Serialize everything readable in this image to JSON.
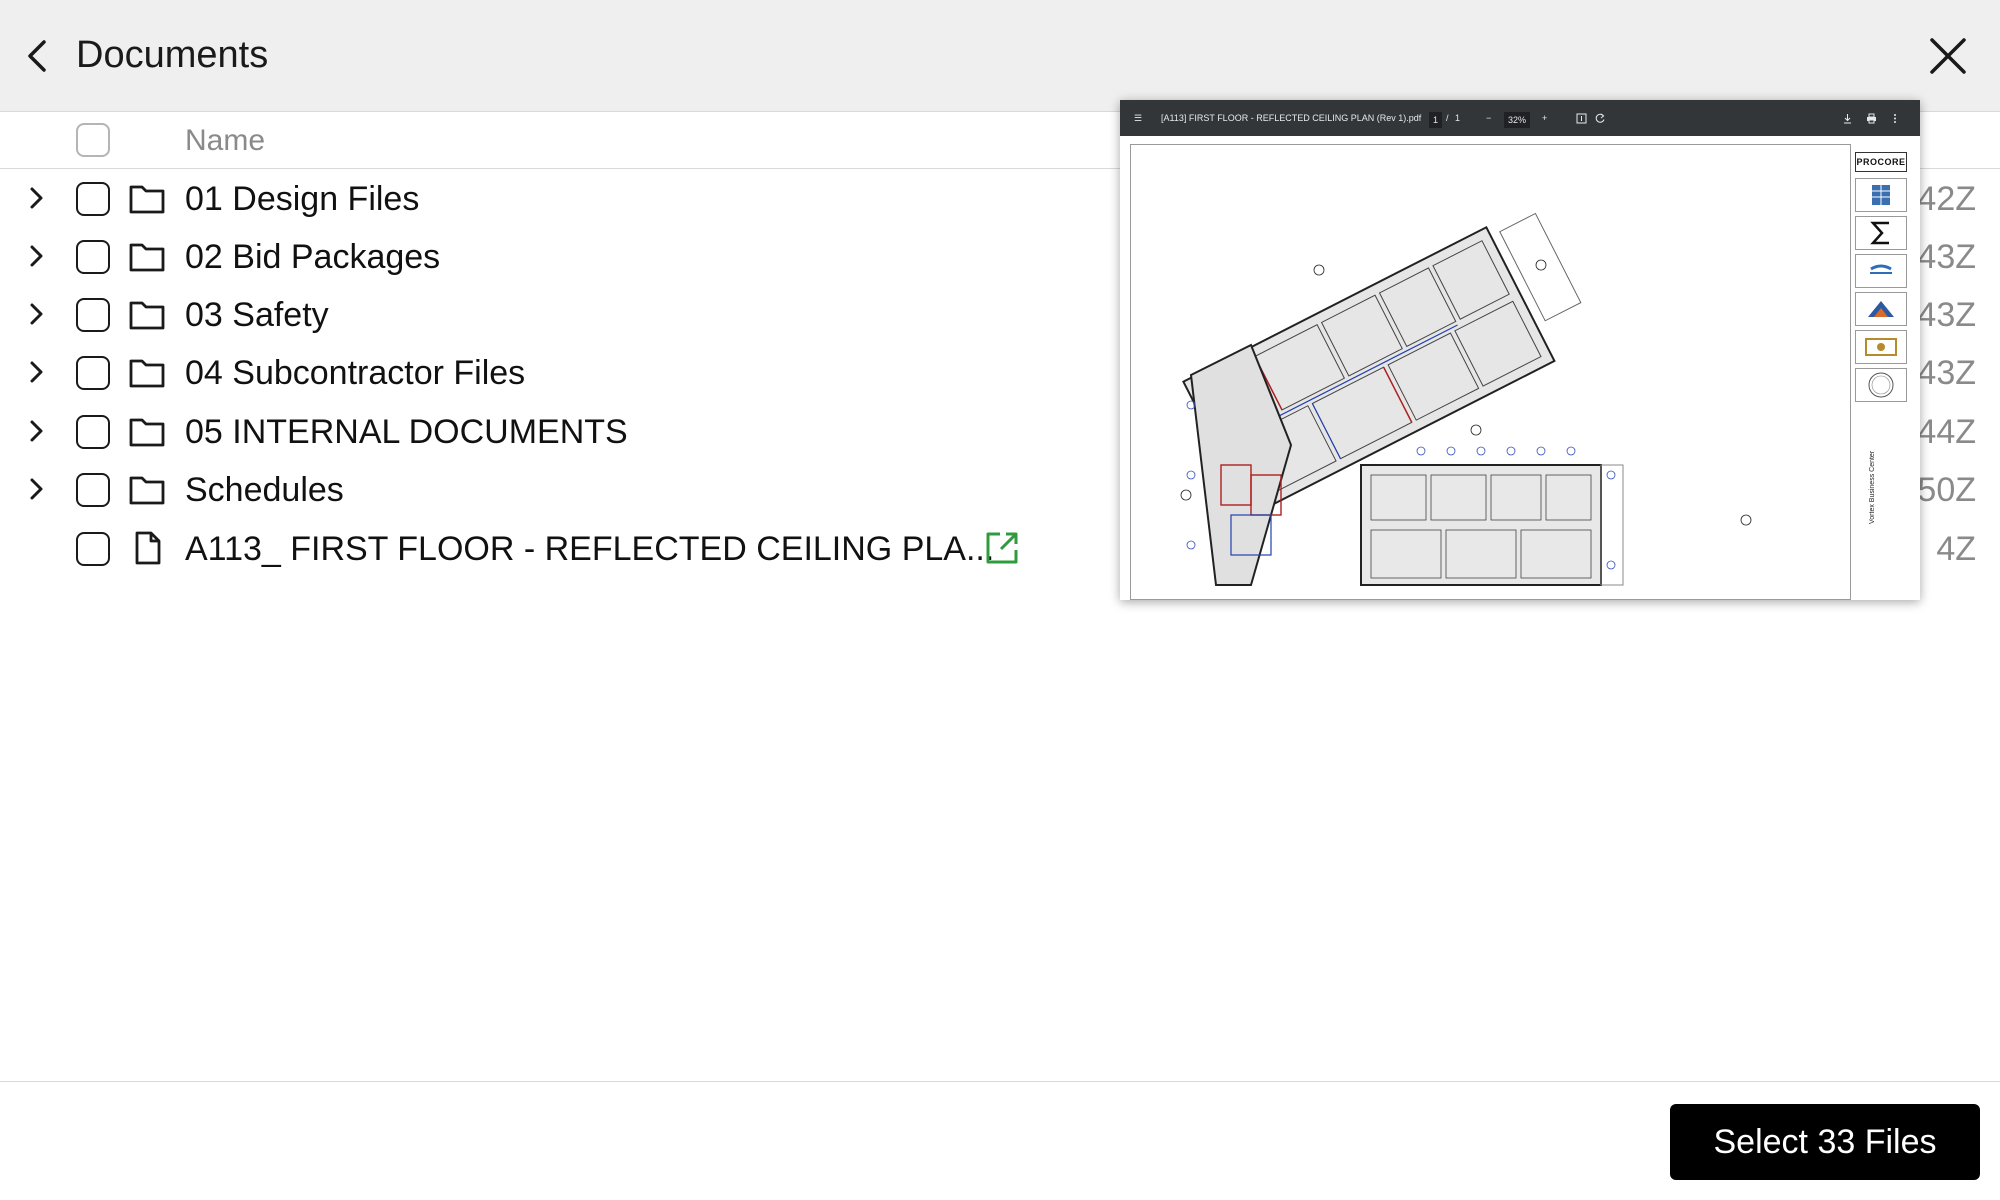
{
  "header": {
    "title": "Documents",
    "back_icon": "chevron-left-icon",
    "close_icon": "close-icon"
  },
  "table": {
    "name_column": "Name"
  },
  "rows": [
    {
      "label": "01 Design Files",
      "type": "folder",
      "date_fragment": "42Z",
      "expandable": true
    },
    {
      "label": "02 Bid Packages",
      "type": "folder",
      "date_fragment": "43Z",
      "expandable": true
    },
    {
      "label": "03 Safety",
      "type": "folder",
      "date_fragment": "43Z",
      "expandable": true
    },
    {
      "label": "04 Subcontractor Files",
      "type": "folder",
      "date_fragment": "43Z",
      "expandable": true
    },
    {
      "label": "05 INTERNAL DOCUMENTS",
      "type": "folder",
      "date_fragment": "44Z",
      "expandable": true
    },
    {
      "label": "Schedules",
      "type": "folder",
      "date_fragment": "50Z",
      "expandable": true
    },
    {
      "label": "A113_ FIRST FLOOR - REFLECTED CEILING PLA...",
      "type": "file",
      "date_fragment": "4Z",
      "expandable": false
    }
  ],
  "preview": {
    "filename": "[A113] FIRST FLOOR - REFLECTED CEILING PLAN (Rev 1).pdf",
    "page_current": "1",
    "page_separator": "/",
    "page_total": "1",
    "zoom": "32%",
    "zoom_out": "−",
    "zoom_in": "+",
    "titleblock_logo": "PROCORE",
    "titleblock_project": "Vortex Business Center"
  },
  "footer": {
    "select_label": "Select 33 Files"
  },
  "colors": {
    "header_bg": "#efefef",
    "link_green": "#2e9c3e",
    "button_bg": "#000000"
  }
}
